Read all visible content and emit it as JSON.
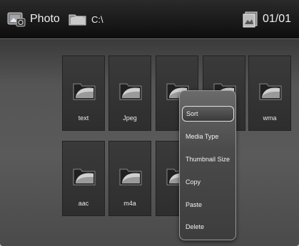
{
  "header": {
    "section_label": "Photo",
    "path": "C:\\",
    "page_indicator": "01/01"
  },
  "icons": {
    "section": "photo-icon",
    "path": "folder-icon",
    "page": "pages-icon",
    "tile": "folder-icon"
  },
  "grid": {
    "items": [
      {
        "label": "text"
      },
      {
        "label": "Jpeg"
      },
      {
        "label": ""
      },
      {
        "label": ""
      },
      {
        "label": "wma"
      },
      {
        "label": "aac"
      },
      {
        "label": "m4a"
      },
      {
        "label": ""
      }
    ]
  },
  "context_menu": {
    "items": [
      {
        "label": "Sort",
        "selected": true
      },
      {
        "label": "Media Type",
        "selected": false
      },
      {
        "label": "Thumbnail Size",
        "selected": false
      },
      {
        "label": "Copy",
        "selected": false
      },
      {
        "label": "Paste",
        "selected": false
      },
      {
        "label": "Delete",
        "selected": false
      }
    ]
  },
  "colors": {
    "header_bg": "#111111",
    "body_bg": "#555555",
    "tile_bg": "#333333",
    "text": "#f0f0f0"
  }
}
